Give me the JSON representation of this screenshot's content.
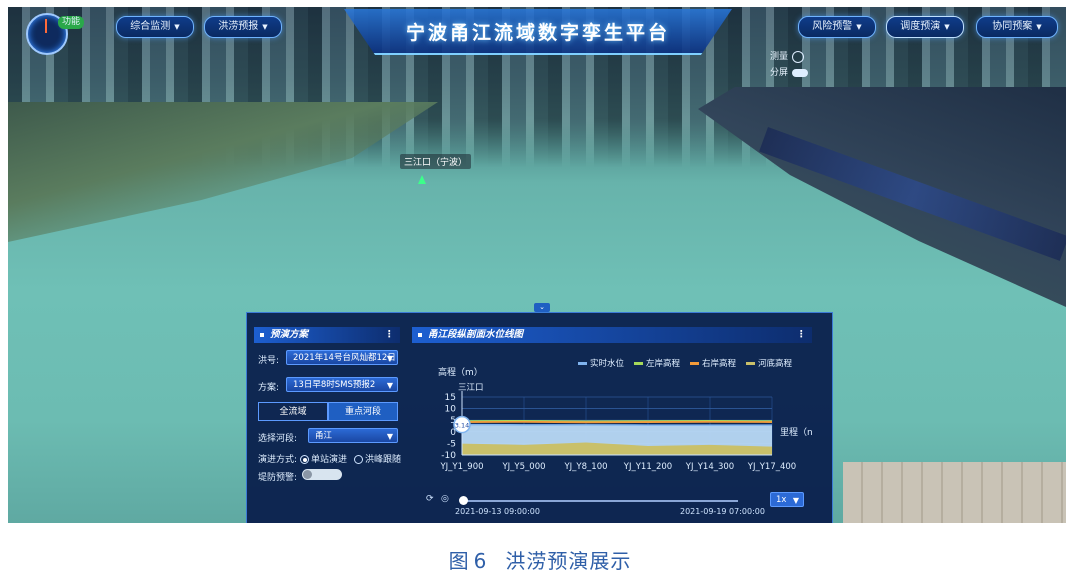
{
  "header": {
    "title": "宁波甬江流域数字孪生平台",
    "func_badge": "功能",
    "nav_left": [
      {
        "label": "综合监测"
      },
      {
        "label": "洪涝预报"
      }
    ],
    "nav_right": [
      {
        "label": "风险预警"
      },
      {
        "label": "调度预演"
      },
      {
        "label": "协同预案"
      }
    ],
    "side_tools": {
      "tool1": "测量",
      "tool2": "分屏"
    }
  },
  "map": {
    "location_label": "三江口（宁波）"
  },
  "plan_panel": {
    "title": "预演方案",
    "flood_label": "洪号:",
    "flood_value": "2021年14号台风灿都12日",
    "scheme_label": "方案:",
    "scheme_value": "13日早8时SMS预报2",
    "tab_all": "全流域",
    "tab_key": "重点河段",
    "reach_label": "选择河段:",
    "reach_value": "甬江",
    "mode_label": "演进方式:",
    "mode_option1": "单站演进",
    "mode_option2": "洪峰跟随",
    "dike_label": "堤防预警:"
  },
  "profile_panel": {
    "title": "甬江段纵剖面水位线图",
    "speed": "1x",
    "time_start": "2021-09-13 09:00:00",
    "time_end": "2021-09-19 07:00:00",
    "playback_progress": 0.0
  },
  "chart_data": {
    "type": "area",
    "ylabel": "高程（m）",
    "xlabel": "里程（n",
    "annotation": "三江口",
    "marker_value": "3.14",
    "ylim": [
      -10,
      15
    ],
    "yticks": [
      15,
      10,
      5,
      0,
      -5,
      -10
    ],
    "x": [
      "YJ_Y1_900",
      "YJ_Y5_000",
      "YJ_Y8_100",
      "YJ_Y11_200",
      "YJ_Y14_300",
      "YJ_Y17_400"
    ],
    "series": [
      {
        "name": "实时水位",
        "color": "#7fb3ee",
        "values": [
          3.1,
          3.0,
          3.0,
          2.9,
          2.9,
          2.9
        ]
      },
      {
        "name": "左岸高程",
        "color": "#a6d95a",
        "values": [
          4.6,
          4.7,
          4.5,
          4.6,
          4.7,
          4.6
        ]
      },
      {
        "name": "右岸高程",
        "color": "#f29a3a",
        "values": [
          4.2,
          4.3,
          4.1,
          4.2,
          4.3,
          4.2
        ]
      },
      {
        "name": "河底高程",
        "color": "#c9c06a",
        "values": [
          -5.5,
          -6.0,
          -5.0,
          -6.5,
          -6.0,
          -6.8
        ]
      }
    ]
  },
  "caption": {
    "figure": "图",
    "number": "6",
    "text": "洪涝预演展示"
  }
}
